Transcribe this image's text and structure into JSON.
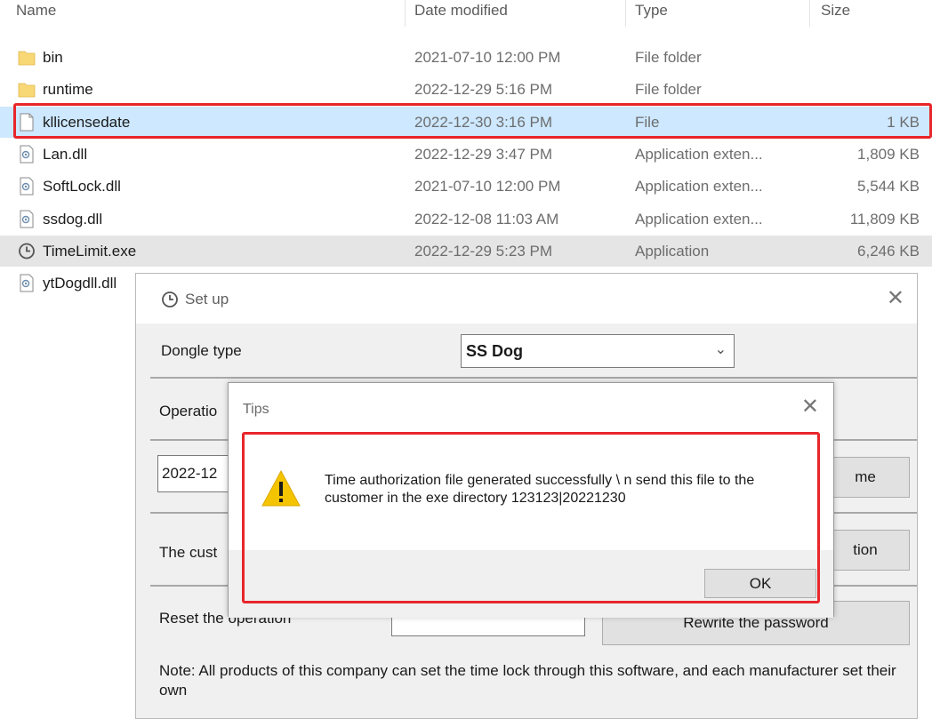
{
  "explorer": {
    "columns": {
      "name": "Name",
      "date": "Date modified",
      "type": "Type",
      "size": "Size"
    },
    "files": [
      {
        "name": "bin",
        "date": "2021-07-10 12:00 PM",
        "type": "File folder",
        "size": "",
        "icon": "folder-icon"
      },
      {
        "name": "runtime",
        "date": "2022-12-29 5:16 PM",
        "type": "File folder",
        "size": "",
        "icon": "folder-icon"
      },
      {
        "name": "kllicensedate",
        "date": "2022-12-30 3:16 PM",
        "type": "File",
        "size": "1 KB",
        "icon": "file-icon",
        "selected": true
      },
      {
        "name": "Lan.dll",
        "date": "2022-12-29 3:47 PM",
        "type": "Application exten...",
        "size": "1,809 KB",
        "icon": "dll-icon"
      },
      {
        "name": "SoftLock.dll",
        "date": "2021-07-10 12:00 PM",
        "type": "Application exten...",
        "size": "5,544 KB",
        "icon": "dll-icon"
      },
      {
        "name": "ssdog.dll",
        "date": "2022-12-08 11:03 AM",
        "type": "Application exten...",
        "size": "11,809 KB",
        "icon": "dll-icon"
      },
      {
        "name": "TimeLimit.exe",
        "date": "2022-12-29 5:23 PM",
        "type": "Application",
        "size": "6,246 KB",
        "icon": "clock-icon",
        "hovered": true
      },
      {
        "name": "ytDogdll.dll",
        "date": "",
        "type": "",
        "size": "",
        "icon": "dll-icon"
      }
    ]
  },
  "setup": {
    "title": "Set up",
    "dongle_label": "Dongle type",
    "dongle_value": "SS Dog",
    "operation_label": "Operatio",
    "date_value": "2022-12",
    "time_button": "me",
    "customer_label": "The cust",
    "operation_button": "tion",
    "reset_label": "Reset the operation",
    "reset_value": "",
    "rewrite_button": "Rewrite the password",
    "note": "Note: All products of this company can set the time lock through this software, and each manufacturer set their own"
  },
  "tips": {
    "title": "Tips",
    "message": "Time authorization file generated successfully \\ n send this file to the customer in the exe directory 123123|20221230",
    "ok": "OK",
    "icon": "warning-icon"
  },
  "colors": {
    "highlight": "#e8262b",
    "selection": "#cde8ff",
    "warning": "#f5c400"
  }
}
